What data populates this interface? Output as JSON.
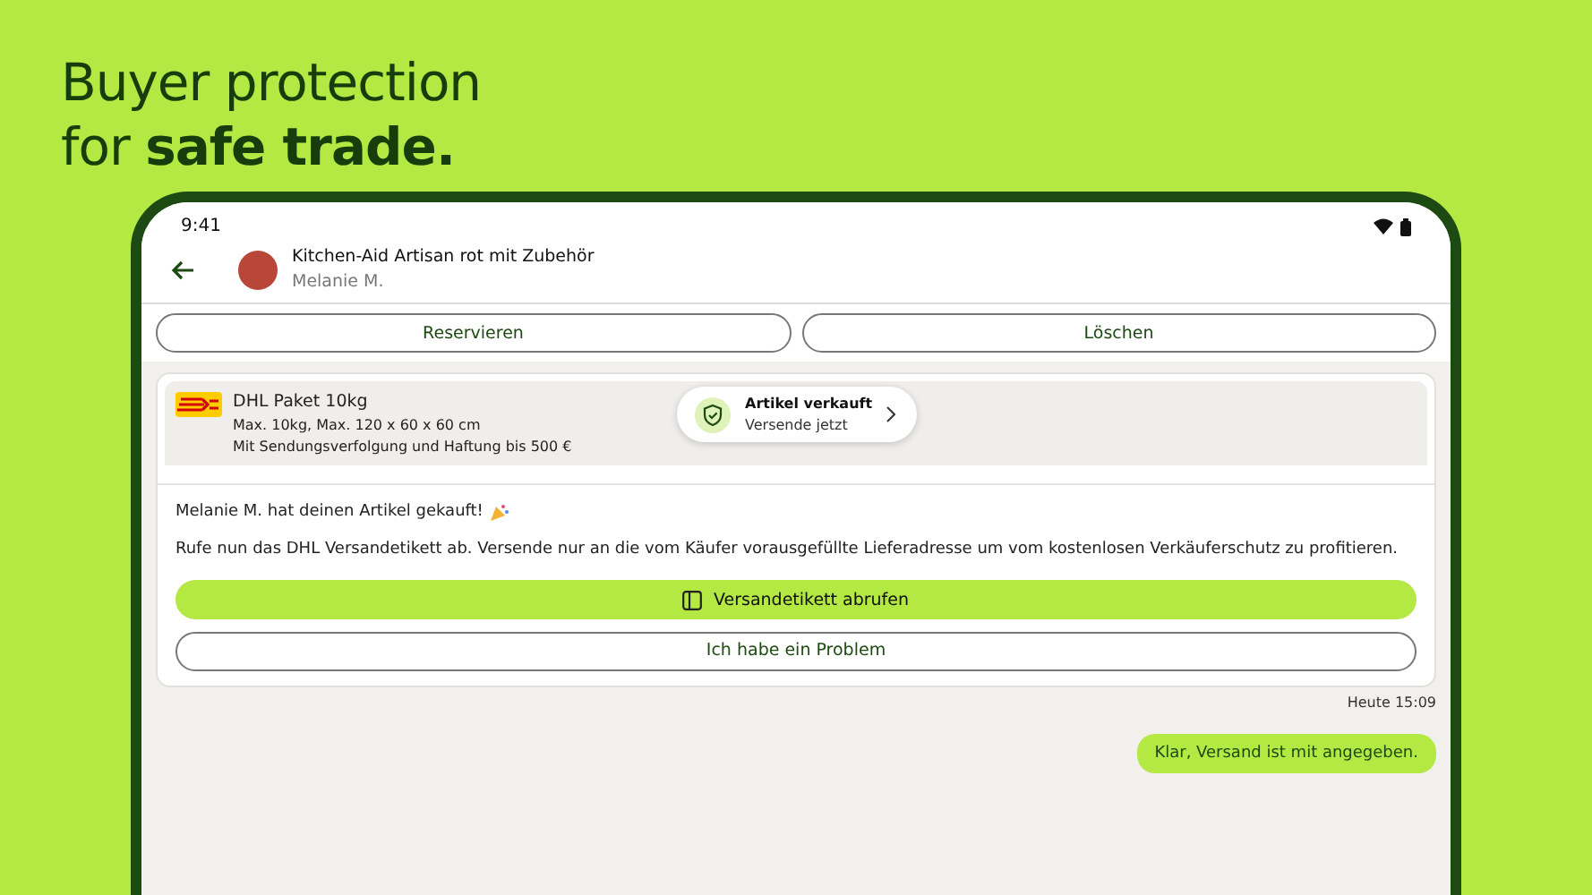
{
  "headline": {
    "line_1": "Buyer protection",
    "line_2": "for **safe trade.**"
  },
  "status_bar": {
    "time": "9:41"
  },
  "header": {
    "title": "Kitchen-Aid Artisan rot mit Zubehör",
    "subtitle": "Melanie M."
  },
  "actions": [
    "Reservieren",
    "Löschen"
  ],
  "shipping": {
    "service": "DHL Paket 10kg",
    "limits": "Max. 10kg, Max. 120 x 60 x 60 cm",
    "tracking": "Mit Sendungsverfolgung und Haftung bis 500 €"
  },
  "toast": {
    "title": "Artikel verkauft",
    "subtitle": "Versende jetzt"
  },
  "message": {
    "heading": "Melanie M. hat deinen Artikel gekauft!",
    "body": "Rufe nun das DHL Versandetikett ab. Versende nur an die vom Käufer vorausgefüllte Lieferadresse um vom kostenlosen Verkäuferschutz zu profitieren.",
    "primary_button": "Versandetikett abrufen",
    "secondary_button": "Ich habe ein Problem"
  },
  "timestamp": "Heute 15:09",
  "reply": "Klar, Versand ist mit angegeben."
}
